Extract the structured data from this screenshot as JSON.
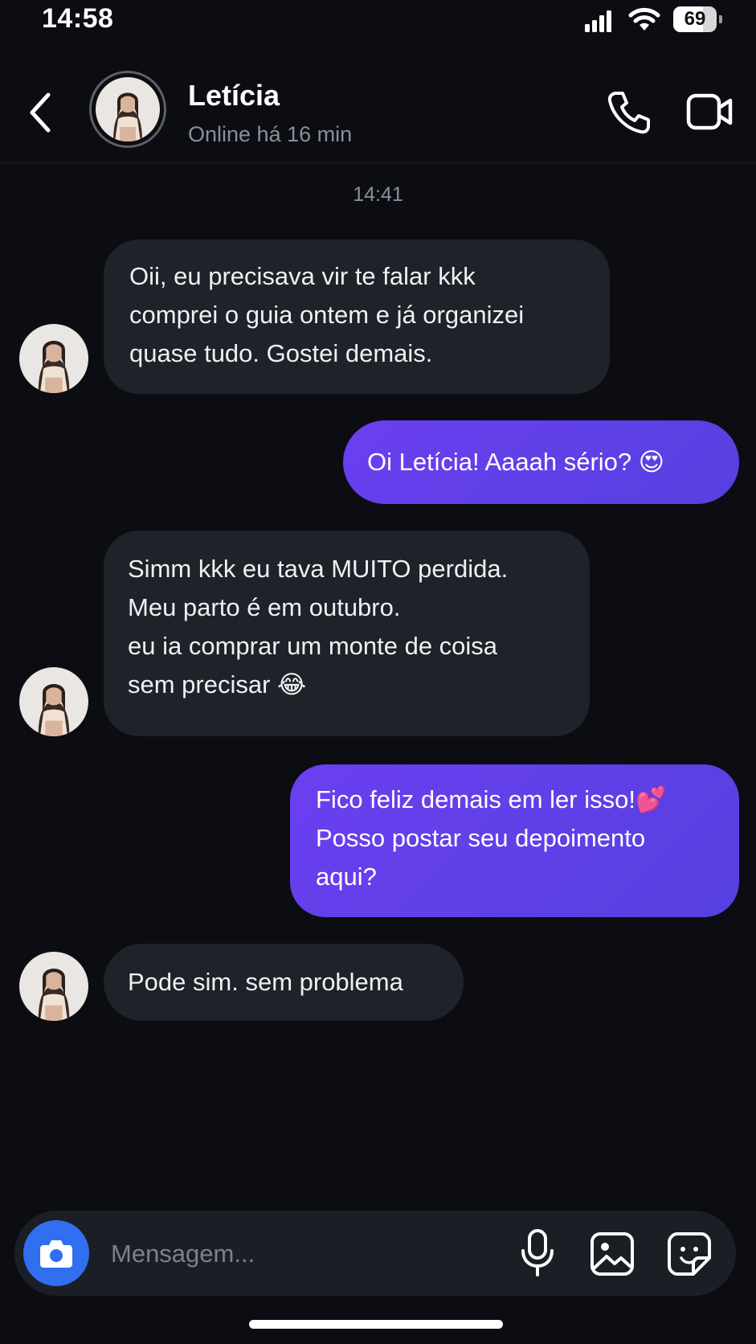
{
  "status_bar": {
    "time": "14:58",
    "battery_level": "69",
    "battery_fraction": 0.69
  },
  "header": {
    "contact_name": "Letícia",
    "contact_status": "Online há 16 min",
    "icons": [
      "back-icon",
      "avatar",
      "phone-icon",
      "video-camera-icon"
    ]
  },
  "chat": {
    "timestamp": "14:41",
    "messages": [
      {
        "direction": "incoming",
        "text": "Oii, eu precisava vir te falar kkk\ncomprei o guia ontem e já organizei\nquase tudo. Gostei demais."
      },
      {
        "direction": "outgoing",
        "text": "Oi Letícia! Aaaah sério? 😍"
      },
      {
        "direction": "incoming",
        "text": "Simm kkk eu tava MUITO perdida.\nMeu parto é em outubro.\neu ia comprar um monte de coisa\nsem precisar 😂"
      },
      {
        "direction": "outgoing",
        "text": "Fico feliz demais em ler isso!💕\nPosso postar seu depoimento\naqui?"
      },
      {
        "direction": "incoming",
        "text": "Pode sim. sem problema"
      }
    ]
  },
  "composer": {
    "placeholder": "Mensagem...",
    "value": "",
    "icons": [
      "camera-icon",
      "microphone-icon",
      "gallery-icon",
      "sticker-icon"
    ]
  },
  "colors": {
    "background": "#0b0d12",
    "incoming_bubble": "#1f2229",
    "outgoing_bubble": "#5a3fe6",
    "camera_button": "#2f6ff0",
    "muted_text": "#8a8f99"
  }
}
